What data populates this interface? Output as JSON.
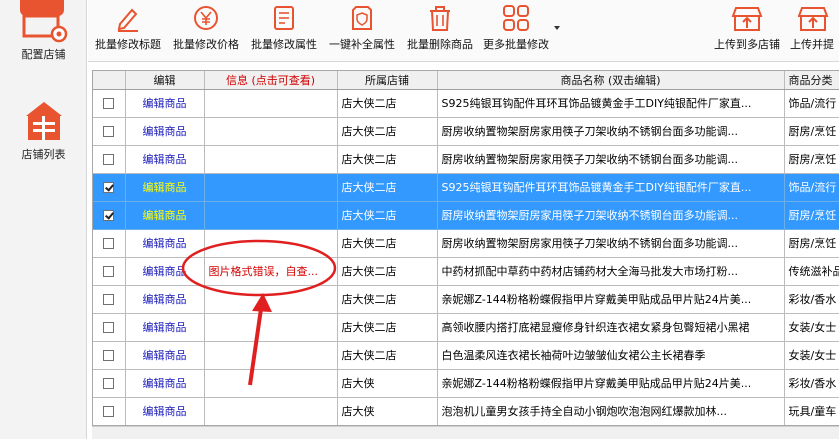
{
  "sidebar": {
    "items": [
      {
        "label": "配置店铺",
        "icon": "store-settings-icon"
      },
      {
        "label": "店铺列表",
        "icon": "shop-list-icon"
      }
    ]
  },
  "toolbar": {
    "buttons": [
      {
        "label": "批量修改标题",
        "icon": "pencil-icon"
      },
      {
        "label": "批量修改价格",
        "icon": "yen-coin-icon"
      },
      {
        "label": "批量修改属性",
        "icon": "list-edit-icon"
      },
      {
        "label": "一键补全属性",
        "icon": "document-shield-icon"
      },
      {
        "label": "批量删除商品",
        "icon": "trash-icon"
      },
      {
        "label": "更多批量修改",
        "icon": "grid-more-icon"
      },
      {
        "label": "上传到多店铺",
        "icon": "upload-stores-icon"
      },
      {
        "label": "上传并提",
        "icon": "upload-submit-icon"
      }
    ]
  },
  "grid": {
    "columns": [
      "",
      "编辑",
      "信息 (点击可查看)",
      "所属店铺",
      "商品名称 (双击编辑)",
      "商品分类"
    ],
    "rows": [
      {
        "checked": false,
        "selected": false,
        "edit": "编辑商品",
        "info": "",
        "shop": "店大侠二店",
        "name": "S925纯银耳钩配件耳环耳饰品镀黄金手工DIY纯银配件厂家直...",
        "cat": "饰品/流行"
      },
      {
        "checked": false,
        "selected": false,
        "edit": "编辑商品",
        "info": "",
        "shop": "店大侠二店",
        "name": "厨房收纳置物架厨房家用筷子刀架收纳不锈钢台面多功能调...",
        "cat": "厨房/烹饪"
      },
      {
        "checked": false,
        "selected": false,
        "edit": "编辑商品",
        "info": "",
        "shop": "店大侠二店",
        "name": "厨房收纳置物架厨房家用筷子刀架收纳不锈钢台面多功能调...",
        "cat": "厨房/烹饪"
      },
      {
        "checked": true,
        "selected": true,
        "edit": "编辑商品",
        "info": "",
        "shop": "店大侠二店",
        "name": "S925纯银耳钩配件耳环耳饰品镀黄金手工DIY纯银配件厂家直...",
        "cat": "饰品/流行"
      },
      {
        "checked": true,
        "selected": true,
        "edit": "编辑商品",
        "info": "",
        "shop": "店大侠二店",
        "name": "厨房收纳置物架厨房家用筷子刀架收纳不锈钢台面多功能调...",
        "cat": "厨房/烹饪"
      },
      {
        "checked": false,
        "selected": false,
        "edit": "编辑商品",
        "info": "",
        "shop": "店大侠二店",
        "name": "厨房收纳置物架厨房家用筷子刀架收纳不锈钢台面多功能调...",
        "cat": "厨房/烹饪"
      },
      {
        "checked": false,
        "selected": false,
        "edit": "编辑商品",
        "info": "图片格式错误，自查...",
        "shop": "店大侠二店",
        "name": "中药材抓配中草药中药材店铺药材大全海马批发大市场打粉...",
        "cat": "传统滋补品"
      },
      {
        "checked": false,
        "selected": false,
        "edit": "编辑商品",
        "info": "",
        "shop": "店大侠二店",
        "name": "亲妮娜Z-144粉格粉蝶假指甲片穿戴美甲贴成品甲片贴24片美...",
        "cat": "彩妆/香水"
      },
      {
        "checked": false,
        "selected": false,
        "edit": "编辑商品",
        "info": "",
        "shop": "店大侠二店",
        "name": "高领收腰内搭打底裙显瘦修身针织连衣裙女紧身包臀短裙小黑裙",
        "cat": "女装/女士"
      },
      {
        "checked": false,
        "selected": false,
        "edit": "编辑商品",
        "info": "",
        "shop": "店大侠二店",
        "name": "白色温柔风连衣裙长袖荷叶边皱皱仙女裙公主长裙春季",
        "cat": "女装/女士"
      },
      {
        "checked": false,
        "selected": false,
        "edit": "编辑商品",
        "info": "",
        "shop": "店大侠",
        "name": "亲妮娜Z-144粉格粉蝶假指甲片穿戴美甲贴成品甲片贴24片美...",
        "cat": "彩妆/香水"
      },
      {
        "checked": false,
        "selected": false,
        "edit": "编辑商品",
        "info": "",
        "shop": "店大侠",
        "name": "泡泡机儿童男女孩手持全自动小钢炮吹泡泡网红爆款加林...",
        "cat": "玩具/童车"
      }
    ]
  },
  "colors": {
    "selected_row": "#3399ff",
    "annotation": "#e02020",
    "edit_link": "#1a1ab8",
    "error_text": "#d20000"
  }
}
